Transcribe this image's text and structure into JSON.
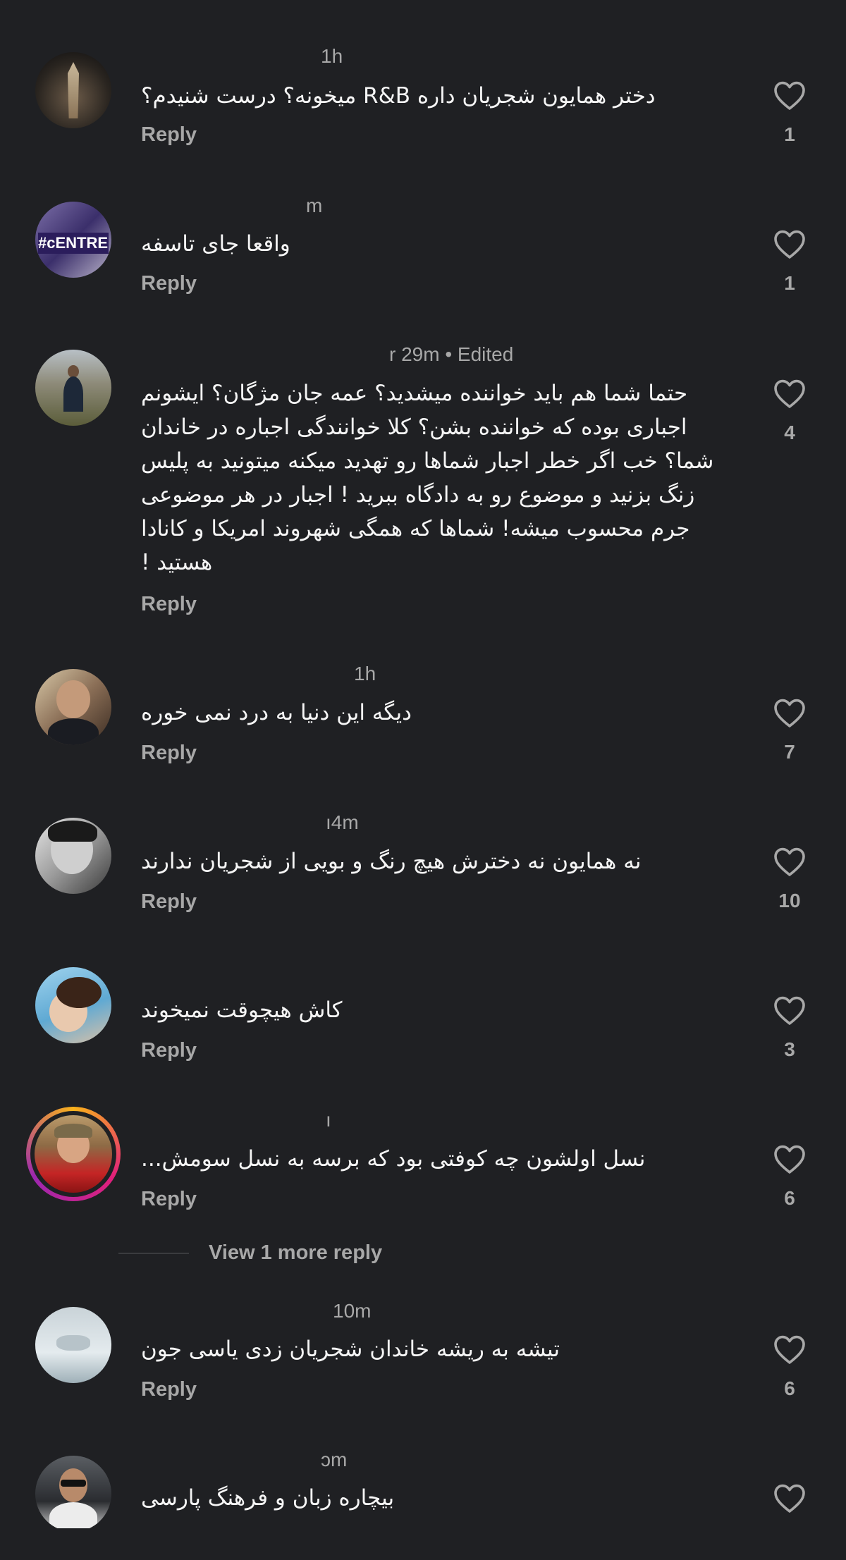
{
  "comments": [
    {
      "time": "1h",
      "text": "دختر همایون شجریان داره R&B میخونه؟ درست شنیدم؟",
      "reply": "Reply",
      "likes": "1",
      "avatar": "tower-avatar"
    },
    {
      "time": "m",
      "text": "واقعا جای تاسفه",
      "reply": "Reply",
      "likes": "1",
      "avatar": "centre-sign-avatar"
    },
    {
      "time": "r 29m • Edited",
      "text": "حتما شما هم باید خواننده میشدید؟ عمه جان مژگان؟ ایشونم اجباری بوده که خواننده بشن؟ کلا خوانندگی اجباره در خاندان شما؟ خب اگر خطر اجبار شماها رو تهدید میکنه میتونید به پلیس زنگ بزنید و موضوع رو به دادگاه ببرید ! اجبار در هر موضوعی جرم محسوب میشه! شماها که همگی شهروند امریکا و کانادا هستید !",
      "reply": "Reply",
      "likes": "4",
      "avatar": "outdoor-man-avatar"
    },
    {
      "time": "1h",
      "text": "دیگه این دنیا به درد نمی خوره",
      "reply": "Reply",
      "likes": "7",
      "avatar": "smiling-man-avatar"
    },
    {
      "time": "ı4m",
      "text": "نه همایون نه دخترش هیچ رنگ و بویی از شجریان ندارند",
      "reply": "Reply",
      "likes": "10",
      "avatar": "bw-portrait-avatar"
    },
    {
      "time": "",
      "text": "کاش هیچوقت نمیخوند",
      "reply": "Reply",
      "likes": "3",
      "avatar": "woman-avatar"
    },
    {
      "time": "ı",
      "text": "نسل  اولشون چه کوفتی بود که برسه به نسل سومش...",
      "reply": "Reply",
      "likes": "6",
      "avatar": "red-shirt-man-avatar"
    },
    {
      "time": "10m",
      "text": "تیشه به ریشه خاندان شجریان زدی یاسی جون",
      "reply": "Reply",
      "likes": "6",
      "avatar": "pale-scene-avatar"
    },
    {
      "time": "ɔm",
      "text": "بیچاره زبان و فرهنگ پارسی",
      "reply": "",
      "likes": "",
      "avatar": "sunglasses-man-avatar"
    }
  ],
  "view_more": "View 1 more reply",
  "colors": {
    "background": "#1f2023",
    "secondary_text": "#a8a8a8",
    "primary_text": "#f5f5f5"
  },
  "icons": {
    "like": "heart-outline-icon"
  }
}
